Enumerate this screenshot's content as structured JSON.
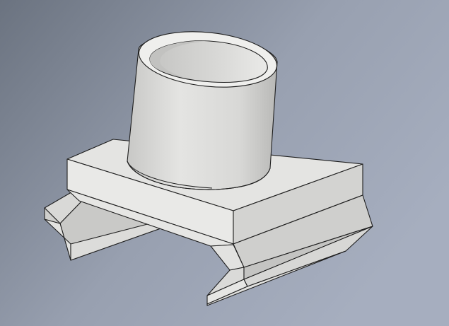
{
  "viewport": {
    "background_top_left": "#6e7682",
    "background_top_right": "#a4acbc",
    "background_bottom": "#8f97a8",
    "model_face_light": "#e6e6e4",
    "model_face_mid": "#d4d4d2",
    "model_face_dark": "#b4b4b2",
    "edge_color": "#1e1e1e"
  },
  "model": {
    "name": "cylinder-on-rail-mount",
    "parts": [
      "base-block",
      "hollow-cylinder",
      "rail-clips"
    ]
  }
}
